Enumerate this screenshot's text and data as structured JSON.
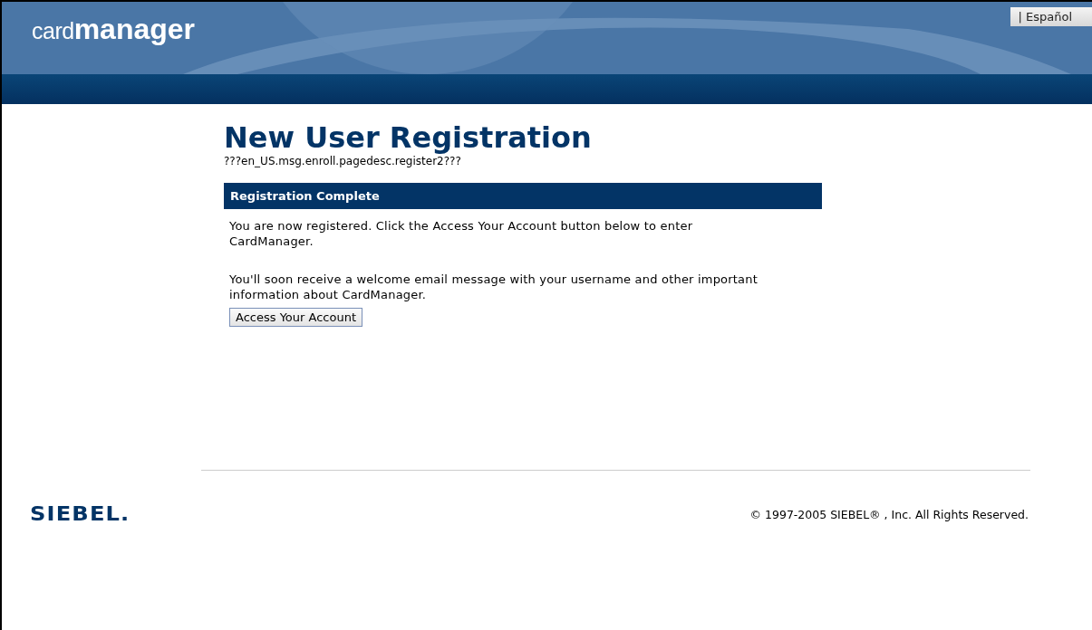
{
  "header": {
    "logo": "card**manager**",
    "language_link": "| Español"
  },
  "page": {
    "title": "New User Registration",
    "description": "???en_US.msg.enroll.pagedesc.register2???"
  },
  "panel": {
    "heading": "Registration Complete",
    "paragraphs": [
      "You are now registered. Click the Access Your Account button below to enter CardManager.",
      "You'll soon receive a welcome email message with your username and other important information about CardManager."
    ],
    "button": "Access Your Account"
  },
  "footer": {
    "brand": "SIEBEL.",
    "copyright": "© 1997-2005 SIEBEL® , Inc. All Rights Reserved."
  }
}
